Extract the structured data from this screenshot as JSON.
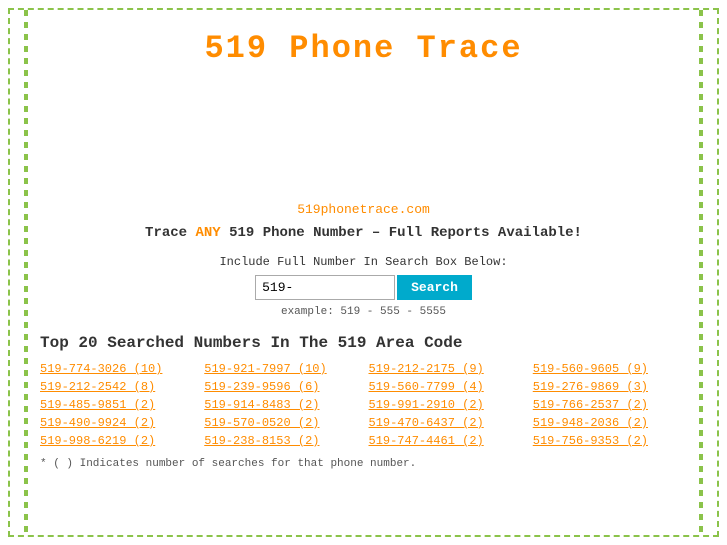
{
  "title": "519 Phone Trace",
  "siteUrl": "519phonetrace.com",
  "tagline_prefix": "Trace ",
  "tagline_any": "ANY",
  "tagline_suffix": " 519 Phone Number – Full Reports Available!",
  "search": {
    "label": "Include Full Number In Search Box Below:",
    "placeholder": "519-",
    "button_label": "Search",
    "example": "example: 519 - 555 - 5555"
  },
  "top20_title": "Top 20 Searched Numbers In The 519 Area Code",
  "numbers": [
    "519-774-3026 (10)",
    "519-921-7997 (10)",
    "519-212-2175 (9)",
    "519-560-9605 (9)",
    "519-212-2542 (8)",
    "519-239-9596 (6)",
    "519-560-7799 (4)",
    "519-276-9869 (3)",
    "519-485-9851 (2)",
    "519-914-8483 (2)",
    "519-991-2910 (2)",
    "519-766-2537 (2)",
    "519-490-9924 (2)",
    "519-570-0520 (2)",
    "519-470-6437 (2)",
    "519-948-2036 (2)",
    "519-998-6219 (2)",
    "519-238-8153 (2)",
    "519-747-4461 (2)",
    "519-756-9353 (2)"
  ],
  "footnote": "* ( ) Indicates number of searches for that phone number."
}
